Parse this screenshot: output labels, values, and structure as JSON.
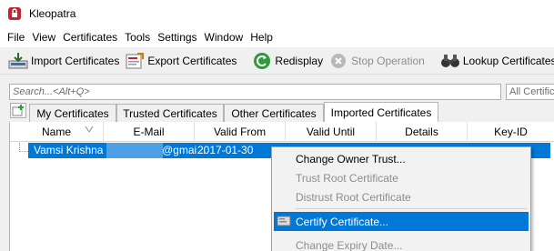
{
  "window": {
    "title": "Kleopatra"
  },
  "menu": [
    "File",
    "View",
    "Certificates",
    "Tools",
    "Settings",
    "Window",
    "Help"
  ],
  "toolbar": {
    "import_label": "Import Certificates",
    "export_label": "Export Certificates",
    "redisplay_label": "Redisplay",
    "stop_label": "Stop Operation",
    "lookup_label": "Lookup Certificates on"
  },
  "search": {
    "placeholder": "Search...<Alt+Q>",
    "filter_value": "All Certific"
  },
  "tabs": [
    "My Certificates",
    "Trusted Certificates",
    "Other Certificates",
    "Imported Certificates"
  ],
  "table": {
    "columns": [
      "Name",
      "E-Mail",
      "Valid From",
      "Valid Until",
      "Details",
      "Key-ID"
    ],
    "row": {
      "name": "Vamsi Krishna",
      "email": "@gmai...",
      "valid_from": "2017-01-30"
    }
  },
  "context_menu": [
    {
      "label": "Change Owner Trust...",
      "enabled": true
    },
    {
      "label": "Trust Root Certificate",
      "enabled": false
    },
    {
      "label": "Distrust Root Certificate",
      "enabled": false
    },
    {
      "label": "Certify Certificate...",
      "enabled": true,
      "highlighted": true
    },
    {
      "label": "Change Expiry Date...",
      "enabled": false
    }
  ],
  "colors": {
    "selection": "#0078d7",
    "toolbar_bg": "#f0f0f0",
    "app_icon": "#c0262d",
    "redisplay_icon": "#2e9a3a"
  },
  "icons": [
    "kleopatra-app-icon",
    "import-icon",
    "export-icon",
    "redisplay-icon",
    "stop-icon",
    "binoculars-icon",
    "new-tab-icon",
    "sort-indicator-icon",
    "certify-icon"
  ]
}
